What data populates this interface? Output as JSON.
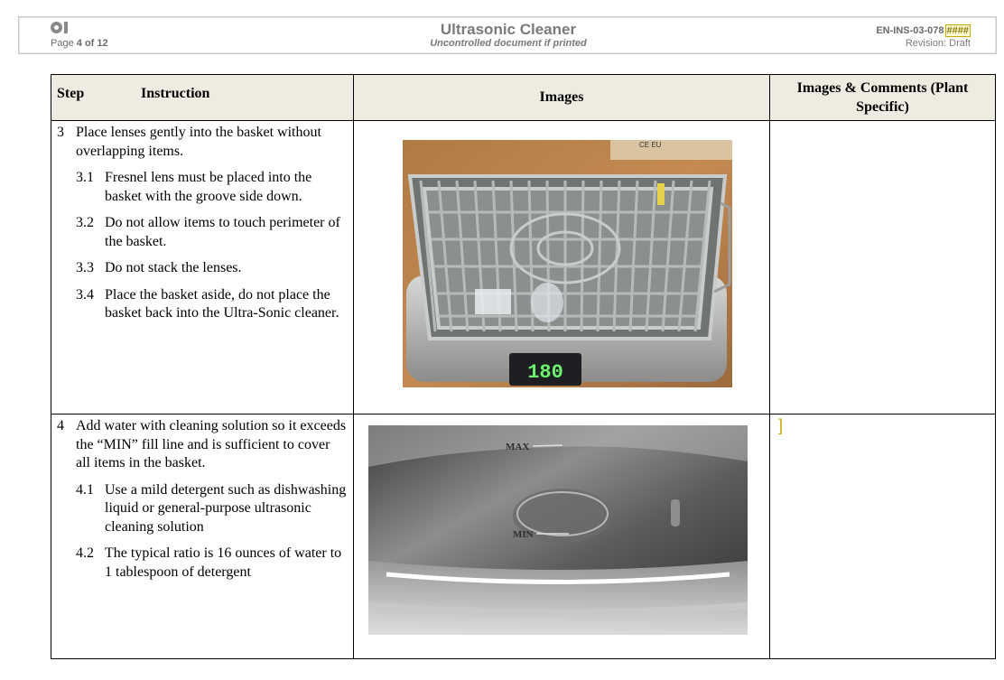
{
  "header": {
    "page_label": "Page",
    "page_current": "4",
    "page_of": "of",
    "page_total": "12",
    "title": "Ultrasonic Cleaner",
    "subtitle": "Uncontrolled document if printed",
    "doc_id": "EN-INS-03-078",
    "doc_id_mark": "####",
    "revision": "Revision: Draft"
  },
  "table": {
    "headers": {
      "step": "Step",
      "instruction": "Instruction",
      "images": "Images",
      "comments": "Images & Comments (Plant Specific)"
    },
    "rows": [
      {
        "step": "3",
        "text": "Place lenses gently into the basket without overlapping items.",
        "subs": [
          {
            "num": "3.1",
            "text": "Fresnel lens must be placed into the basket with the groove side down."
          },
          {
            "num": "3.2",
            "text": "Do not allow items to touch perimeter of the basket."
          },
          {
            "num": "3.3",
            "text": "Do not stack the lenses."
          },
          {
            "num": "3.4",
            "text": "Place the basket aside, do not place the basket back into the Ultra-Sonic cleaner."
          }
        ],
        "image": {
          "icon": "basket-photo",
          "display_reading": "180",
          "box_label": "CE EU"
        }
      },
      {
        "step": "4",
        "text": "Add water with cleaning solution so it exceeds the “MIN” fill line and is sufficient to cover all items in the basket.",
        "subs": [
          {
            "num": "4.1",
            "text": "Use a mild detergent such as dishwashing liquid or general-purpose ultrasonic cleaning solution"
          },
          {
            "num": "4.2",
            "text": "The typical ratio is 16 ounces of water to 1 tablespoon of detergent"
          }
        ],
        "image": {
          "icon": "tank-photo",
          "max_label": "MAX",
          "min_label": "MIN"
        },
        "comment_marker": "]"
      }
    ]
  },
  "colors": {
    "header_fill": "#eeece1",
    "header_text": "#7a7a7a",
    "review_mark": "#c9a800",
    "display_green": "#6cf26c"
  }
}
